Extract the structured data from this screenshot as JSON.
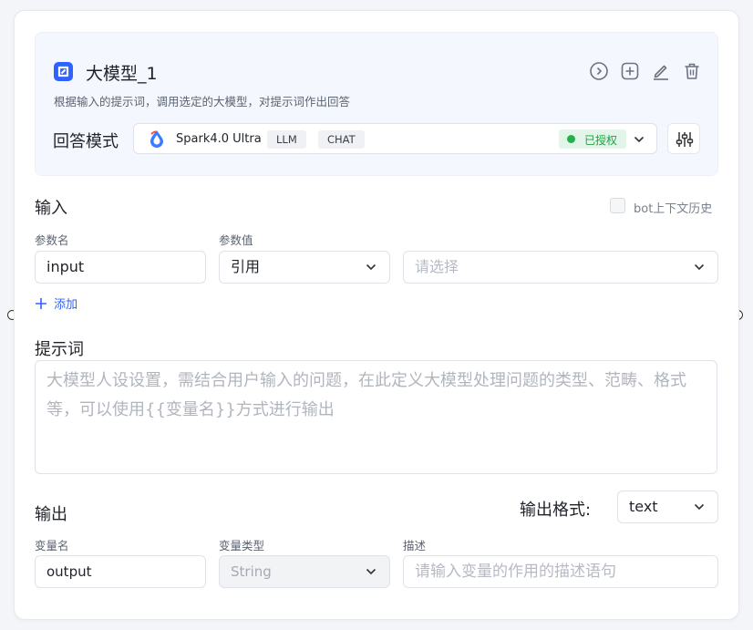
{
  "node": {
    "title": "大模型_1",
    "description": "根据输入的提示词，调用选定的大模型，对提示词作出回答",
    "icon": "llm-node-icon",
    "actions": [
      "run-icon",
      "add-icon",
      "edit-icon",
      "delete-icon"
    ]
  },
  "model": {
    "mode_label": "回答模式",
    "name": "Spark4.0 Ultra",
    "tags": [
      "LLM",
      "CHAT"
    ],
    "auth_status": "已授权",
    "auth_color": "#23b14d"
  },
  "input_section": {
    "title": "输入",
    "history_label": "bot上下文历史",
    "history_checked": false,
    "param_name_label": "参数名",
    "param_value_label": "参数值",
    "param_name_value": "input",
    "param_value_type": "引用",
    "reference_placeholder": "请选择",
    "add_label": "添加"
  },
  "prompt_section": {
    "title": "提示词",
    "placeholder": "大模型人设设置，需结合用户输入的问题，在此定义大模型处理问题的类型、范畴、格式等，可以使用{{变量名}}方式进行输出"
  },
  "output_section": {
    "title": "输出",
    "format_label": "输出格式:",
    "format_value": "text",
    "var_name_label": "变量名",
    "var_type_label": "变量类型",
    "desc_label": "描述",
    "var_name_value": "output",
    "var_type_value": "String",
    "desc_placeholder": "请输入变量的作用的描述语句"
  },
  "colors": {
    "accent": "#2f63ff",
    "header_bg": "#f5f7fe",
    "auth_bg": "#e3f4e8"
  }
}
